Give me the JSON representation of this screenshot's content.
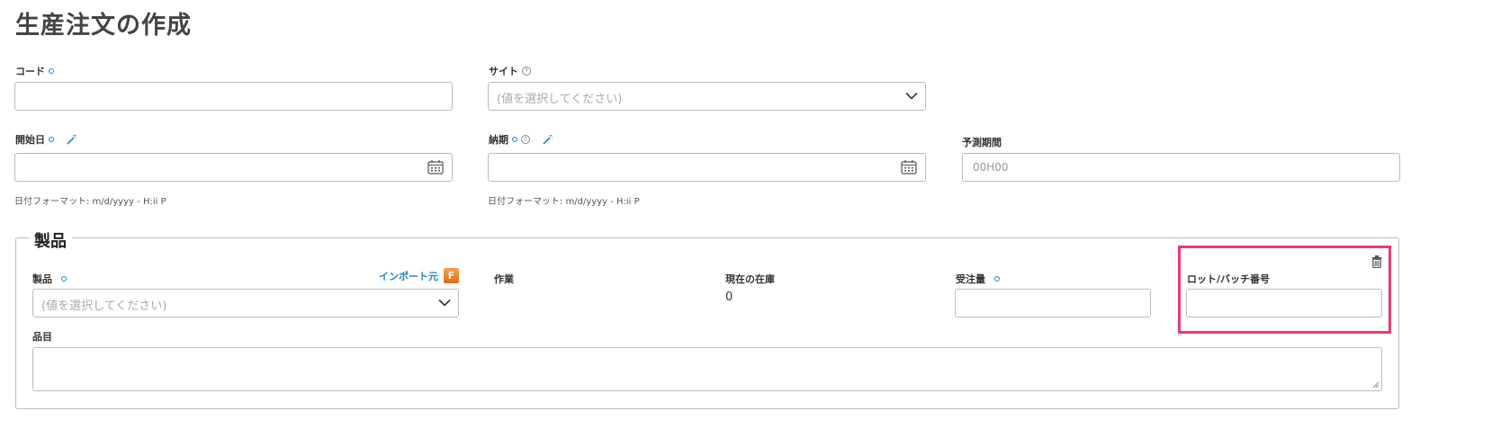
{
  "page": {
    "title": "生産注文の作成"
  },
  "fields": {
    "code": {
      "label": "コード",
      "value": ""
    },
    "site": {
      "label": "サイト",
      "placeholder": "(値を選択してください)"
    },
    "start_date": {
      "label": "開始日",
      "value": "",
      "format_hint": "日付フォーマット: m/d/yyyy - H:ii P"
    },
    "due_date": {
      "label": "納期",
      "value": "",
      "format_hint": "日付フォーマット: m/d/yyyy - H:ii P"
    },
    "forecast_period": {
      "label": "予測期間",
      "placeholder": "00H00"
    }
  },
  "products_section": {
    "legend": "製品",
    "columns": {
      "product": {
        "label": "製品",
        "placeholder": "(値を選択してください)",
        "import_label": "インポート元"
      },
      "task": {
        "label": "作業"
      },
      "current_stock": {
        "label": "現在の在庫",
        "value": "0"
      },
      "order_qty": {
        "label": "受注量",
        "value": ""
      },
      "lot_batch": {
        "label": "ロット/バッチ番号",
        "value": ""
      },
      "item": {
        "label": "品目",
        "value": ""
      }
    }
  },
  "colors": {
    "accent": "#1e88c7",
    "highlight": "#ee3a6e"
  }
}
